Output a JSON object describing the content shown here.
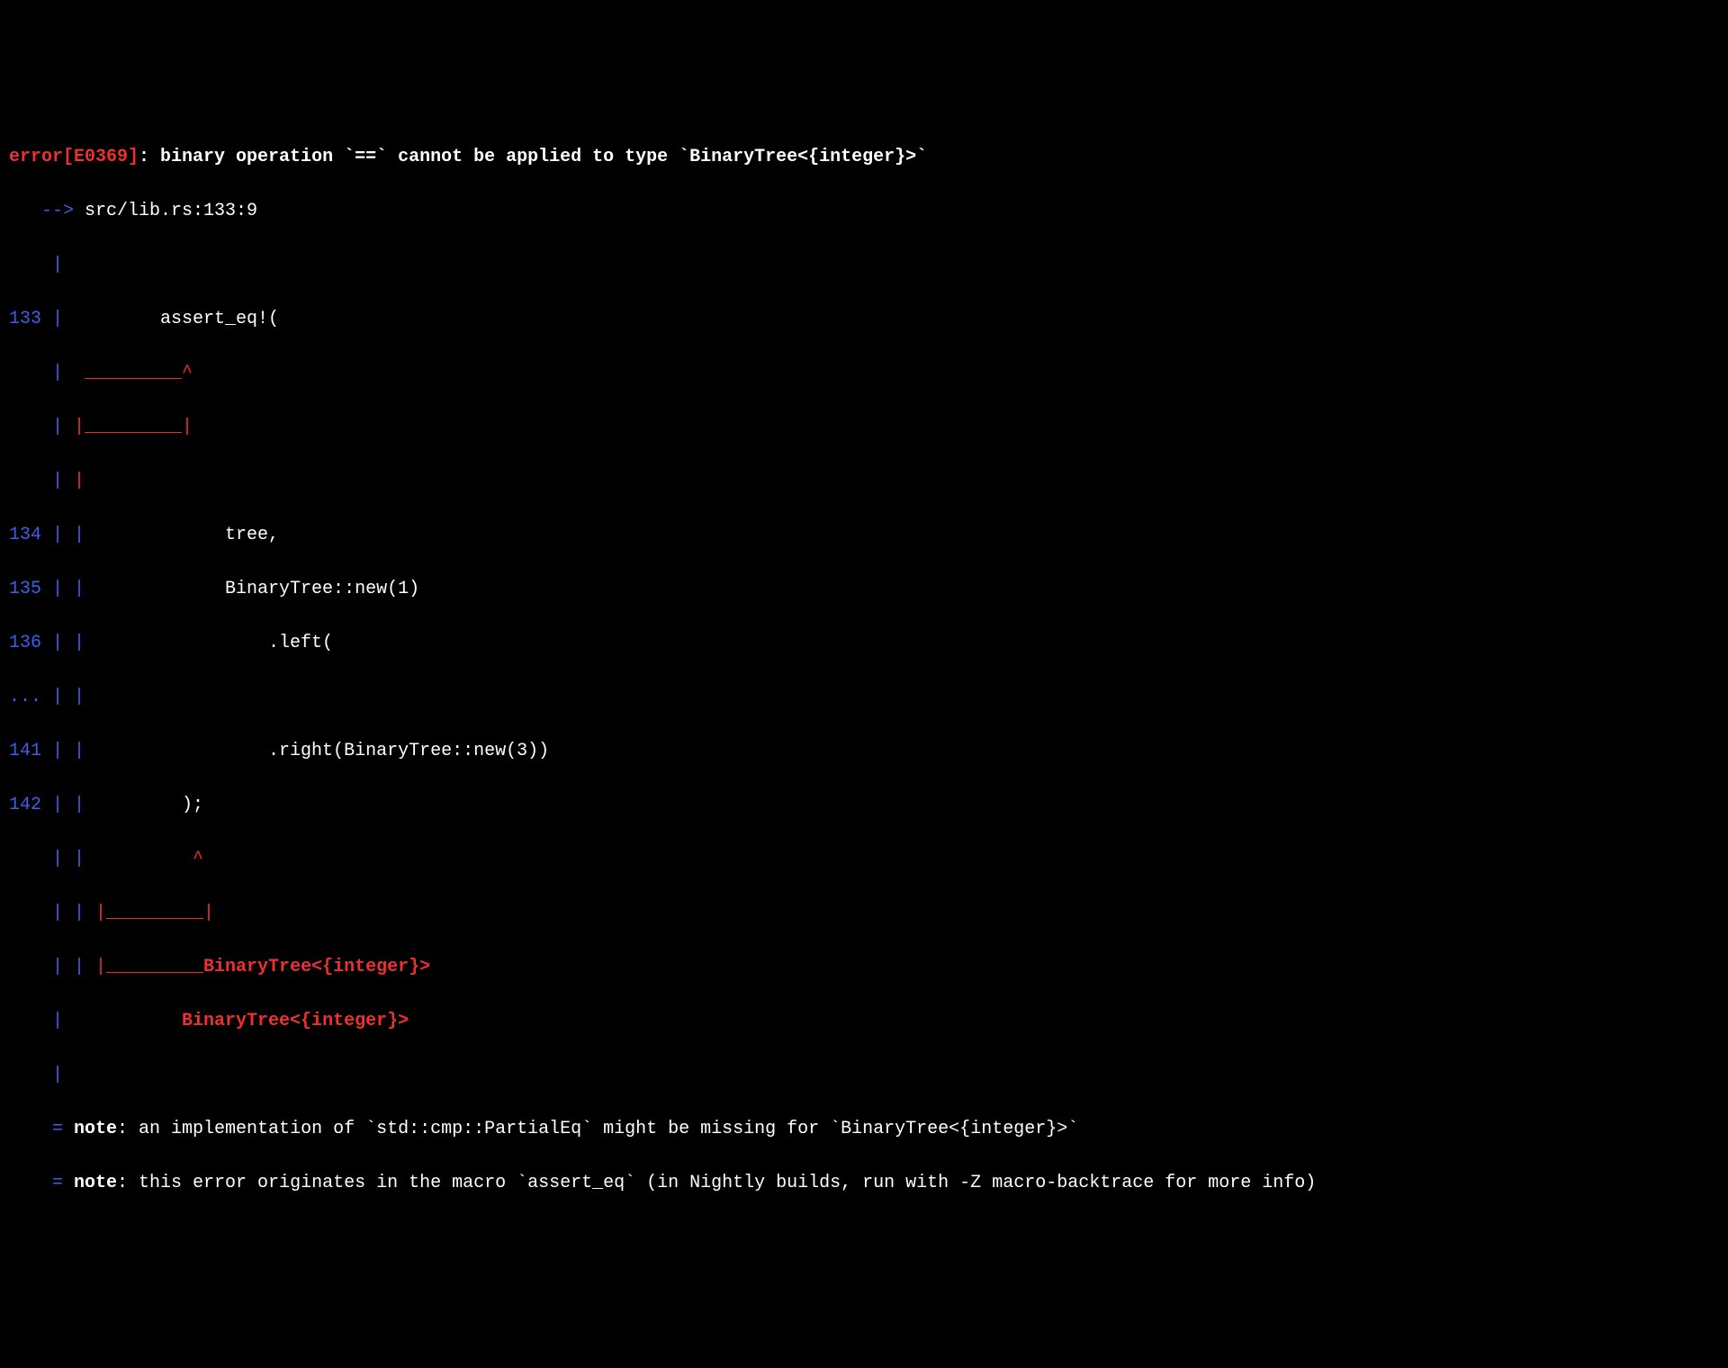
{
  "error": {
    "prefix": "error",
    "code": "[E0369]",
    "message": ": binary operation `==` cannot be applied to type `BinaryTree<{integer}>`"
  },
  "location": {
    "arrow": "   --> ",
    "path": "src/lib.rs:133:9"
  },
  "gutter": {
    "empty": "    |",
    "l133": "133 |",
    "l134": "134 | |",
    "l135": "135 | |",
    "l136": "136 | |",
    "dots": "... | |",
    "l141": "141 | |",
    "l142": "142 | |",
    "cont": "    | |",
    "equal": "    = "
  },
  "code": {
    "l133": "         assert_eq!(",
    "caret133a": "  _________^",
    "caret133b": " |_________|",
    "blankpipe": " |",
    "l134": "             tree,",
    "l135": "             BinaryTree::new(1)",
    "l136": "                 .left(",
    "l141": "                 .right(BinaryTree::new(3))",
    "l142": "         );",
    "caret142": "          ^",
    "caret_close1": " |_________|",
    "caret_close2_u": " |_________",
    "err_type1": "BinaryTree<{integer}>",
    "err_type2": "           BinaryTree<{integer}>"
  },
  "notes": {
    "label": "note",
    "note1": ": an implementation of `std::cmp::PartialEq` might be missing for `BinaryTree<{integer}>`",
    "note2": ": this error originates in the macro `assert_eq` (in Nightly builds, run with -Z macro-backtrace for more info)"
  }
}
